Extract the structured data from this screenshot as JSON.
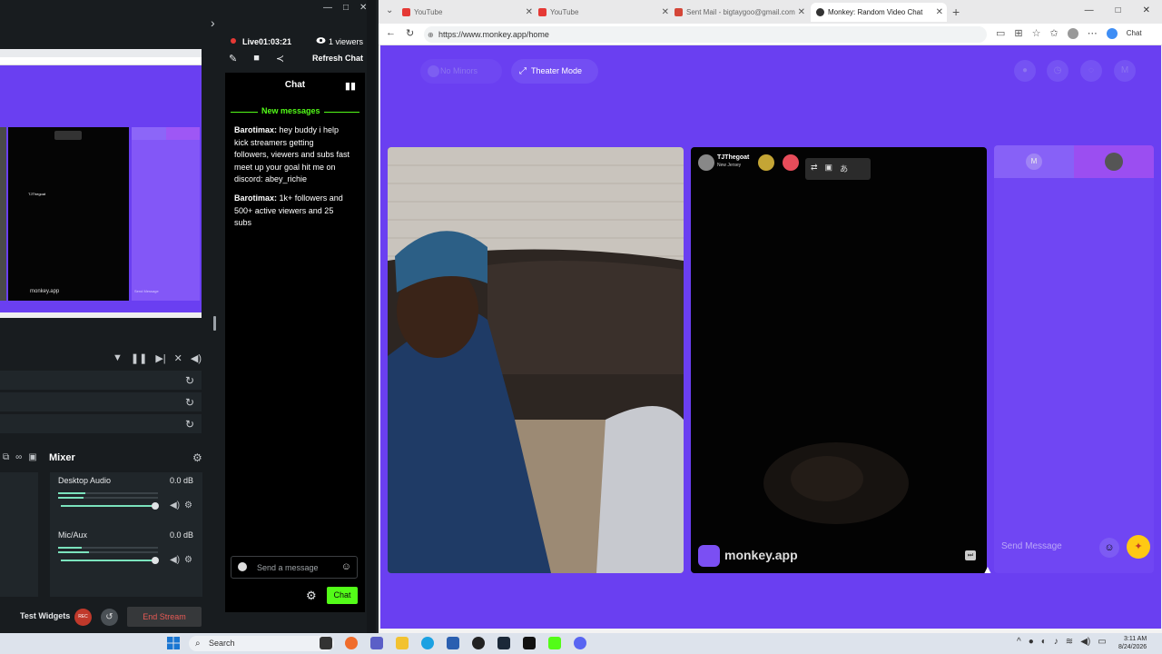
{
  "streamer": {
    "live_time": "Live01:03:21",
    "viewers": "1 viewers",
    "refresh_chat": "Refresh Chat",
    "chat_title": "Chat",
    "new_messages": "New messages",
    "messages": [
      {
        "user": "Barotimax:",
        "text": " hey buddy i help kick streamers getting followers, viewers and subs fast meet up your goal hit me on discord: abey_richie"
      },
      {
        "user": "Barotimax:",
        "text": " 1k+ followers and 500+ active viewers and 25 subs"
      }
    ],
    "chat_placeholder": "Send a message",
    "chat_send": "Chat",
    "mixer_title": "Mixer",
    "desktop_audio_label": "Desktop Audio",
    "desktop_audio_db": "0.0 dB",
    "mic_label": "Mic/Aux",
    "mic_db": "0.0 dB",
    "test_widgets": "Test Widgets",
    "rec": "REC",
    "end_stream": "End Stream",
    "preview_app": "monkey.app",
    "preview_user": "TJThegoat",
    "preview_send": "Send Message",
    "accent_color": "#53fc18"
  },
  "browser": {
    "tabs": [
      {
        "title": "YouTube"
      },
      {
        "title": "YouTube"
      },
      {
        "title": "Sent Mail - bigtaygoo@gmail.com"
      },
      {
        "title": "Monkey: Random Video Chat"
      }
    ],
    "url": "https://www.monkey.app/home",
    "copilot": "Chat"
  },
  "monkey": {
    "no_minors": "No Minors",
    "theater_mode": "Theater Mode",
    "remote_user": "TJThegoat",
    "remote_location": "New Jersey",
    "logo_text": "monkey.app",
    "chat_avatar_letter": "M",
    "top_avatar_letter": "M",
    "send_message_placeholder": "Send Message",
    "brand_color": "#6a3ff1"
  },
  "taskbar": {
    "search": "Search",
    "time": "3:11 AM",
    "date": "8/24/2026"
  }
}
